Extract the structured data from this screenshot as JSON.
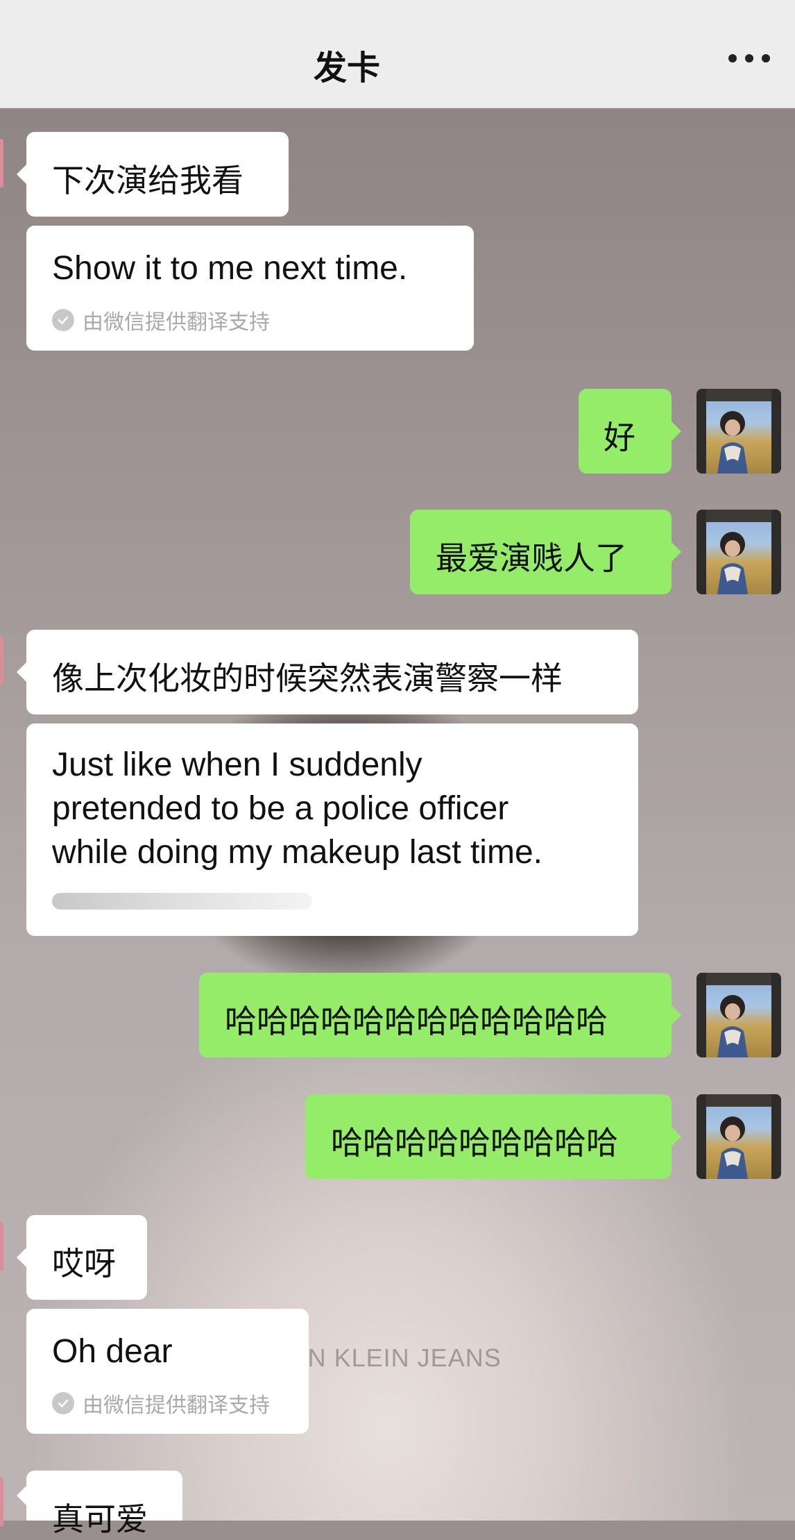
{
  "nav": {
    "title": "发卡"
  },
  "background": {
    "watermark": "CALVIN KLEIN JEANS"
  },
  "messages": [
    {
      "side": "in",
      "text": "下次演给我看"
    },
    {
      "side": "in",
      "translation": "Show it to me next time.",
      "note": "由微信提供翻译支持"
    },
    {
      "side": "out",
      "text": "好"
    },
    {
      "side": "out",
      "text": "最爱演贱人了"
    },
    {
      "side": "in",
      "text": "像上次化妆的时候突然表演警察一样"
    },
    {
      "side": "in",
      "translation_lines": [
        "Just like when I suddenly",
        "pretended to be a police officer",
        "while doing my makeup last time."
      ],
      "progress": 0.6
    },
    {
      "side": "out",
      "text": "哈哈哈哈哈哈哈哈哈哈哈哈"
    },
    {
      "side": "out",
      "text": "哈哈哈哈哈哈哈哈哈"
    },
    {
      "side": "in",
      "text": "哎呀"
    },
    {
      "side": "in",
      "translation": "Oh dear",
      "note": "由微信提供翻译支持"
    },
    {
      "side": "in",
      "text": "真可爱"
    }
  ]
}
